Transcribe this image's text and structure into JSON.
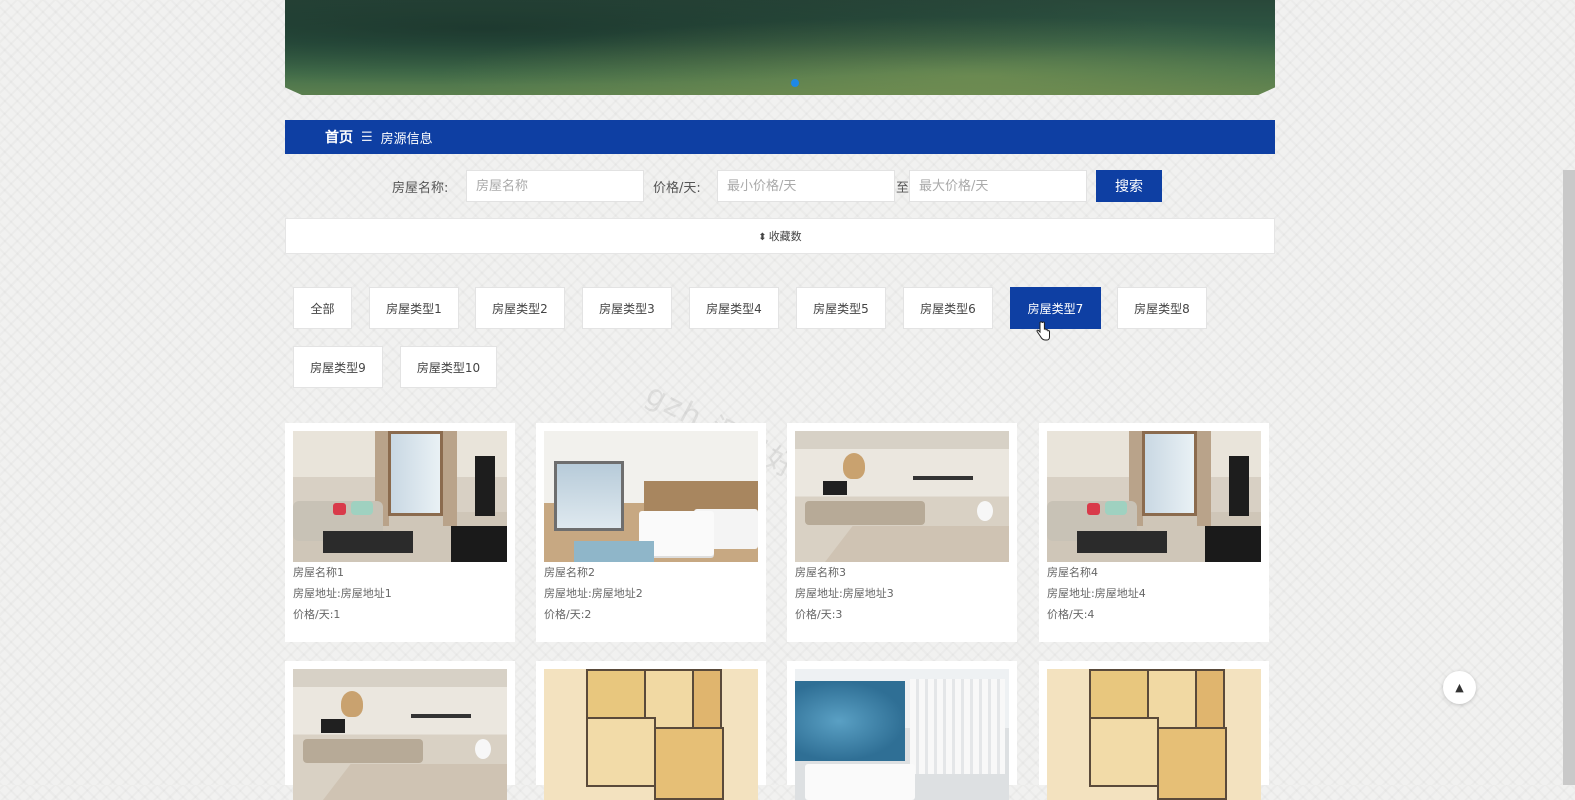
{
  "breadcrumb": {
    "home": "首页",
    "separator": "☰",
    "current": "房源信息"
  },
  "search": {
    "name_label": "房屋名称:",
    "name_placeholder": "房屋名称",
    "price_label": "价格/天:",
    "min_placeholder": "最小价格/天",
    "range_sep": "至",
    "max_placeholder": "最大价格/天",
    "button": "搜索"
  },
  "sort": {
    "icon": "sort-icon",
    "label": "收藏数"
  },
  "categories": {
    "items": [
      "全部",
      "房屋类型1",
      "房屋类型2",
      "房屋类型3",
      "房屋类型4",
      "房屋类型5",
      "房屋类型6",
      "房屋类型7",
      "房屋类型8",
      "房屋类型9",
      "房屋类型10"
    ],
    "active": "房屋类型7"
  },
  "watermark": "gzh 源码好优多",
  "listings": [
    {
      "name": "房屋名称1",
      "address": "房屋地址:房屋地址1",
      "price": "价格/天:1",
      "image": "living-room"
    },
    {
      "name": "房屋名称2",
      "address": "房屋地址:房屋地址2",
      "price": "价格/天:2",
      "image": "bedroom"
    },
    {
      "name": "房屋名称3",
      "address": "房屋地址:房屋地址3",
      "price": "价格/天:3",
      "image": "dining-room"
    },
    {
      "name": "房屋名称4",
      "address": "房屋地址:房屋地址4",
      "price": "价格/天:4",
      "image": "living-room"
    },
    {
      "image": "dining-room"
    },
    {
      "image": "floor-plan"
    },
    {
      "image": "blue-bedroom"
    },
    {
      "image": "floor-plan"
    }
  ],
  "back_to_top": {
    "icon": "arrow-up-icon",
    "glyph": "▲"
  },
  "colors": {
    "primary": "#0e3fa3",
    "carousel_dot": "#1e88e5"
  }
}
